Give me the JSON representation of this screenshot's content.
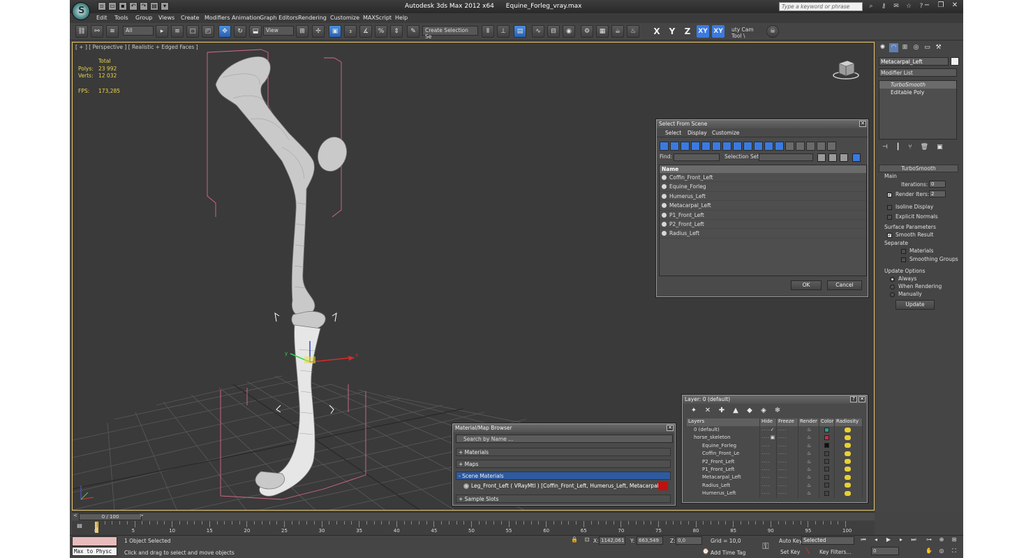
{
  "window": {
    "app_title": "Autodesk 3ds Max  2012 x64",
    "file_name": "Equine_Forleg_vray.max",
    "search_placeholder": "Type a keyword or phrase"
  },
  "menu": [
    "Edit",
    "Tools",
    "Group",
    "Views",
    "Create",
    "Modifiers",
    "Animation",
    "Graph Editors",
    "Rendering",
    "Customize",
    "MAXScript",
    "Help"
  ],
  "toolbar": {
    "selection_filter": "All",
    "reference_coord": "View",
    "named_selection_set": "Create Selection Se",
    "axes": [
      "X",
      "Y",
      "Z",
      "XY",
      "XY"
    ],
    "shortcut_tool": "uty Cam Tool \\"
  },
  "viewport": {
    "label": "[ + ] [ Perspective ] [ Realistic + Edged Faces ]",
    "stats_header": "Total",
    "polys_label": "Polys:",
    "polys_value": "23 992",
    "verts_label": "Verts:",
    "verts_value": "12 032",
    "fps_label": "FPS:",
    "fps_value": "173,285"
  },
  "select_from_scene": {
    "title": "Select From Scene",
    "menu": [
      "Select",
      "Display",
      "Customize"
    ],
    "find_label": "Find:",
    "selection_set_label": "Selection Set:",
    "column_name": "Name",
    "objects": [
      "Coffin_Front_Left",
      "Equine_Forleg",
      "Humerus_Left",
      "Metacarpal_Left",
      "P1_Front_Left",
      "P2_Front_Left",
      "Radius_Left"
    ],
    "ok_label": "OK",
    "cancel_label": "Cancel"
  },
  "layer_dialog": {
    "title": "Layer: 0 (default)",
    "help": "?",
    "columns": [
      "Layers",
      "Hide",
      "Freeze",
      "Render",
      "Color",
      "Radiosity"
    ],
    "rows": [
      {
        "name": "0 (default)",
        "indent": 1,
        "color": "#2a9a8a",
        "check": "✓"
      },
      {
        "name": "horse_skeleton",
        "indent": 1,
        "color": "#c0304a",
        "check": "▣"
      },
      {
        "name": "Equine_Forleg",
        "indent": 2,
        "color": "#111111",
        "check": ""
      },
      {
        "name": "Coffin_Front_Le",
        "indent": 2,
        "color": "#444444",
        "check": ""
      },
      {
        "name": "P2_Front_Left",
        "indent": 2,
        "color": "#444444",
        "check": ""
      },
      {
        "name": "P1_Front_Left",
        "indent": 2,
        "color": "#444444",
        "check": ""
      },
      {
        "name": "Metacarpal_Left",
        "indent": 2,
        "color": "#444444",
        "check": ""
      },
      {
        "name": "Radius_Left",
        "indent": 2,
        "color": "#444444",
        "check": ""
      },
      {
        "name": "Humerus_Left",
        "indent": 2,
        "color": "#444444",
        "check": ""
      }
    ]
  },
  "material_browser": {
    "title": "Material/Map Browser",
    "search_placeholder": "Search by Name ...",
    "sections": [
      "+ Materials",
      "+ Maps",
      "- Scene Materials",
      "+ Sample Slots"
    ],
    "scene_material": "Leg_Front_Left  ( VRayMtl ) [Coffin_Front_Left, Humerus_Left, Metacarpal_Left, ..."
  },
  "command_panel": {
    "object_name": "Metacarpal_Left",
    "modifier_list": "Modifier List",
    "stack": [
      "TurboSmooth",
      "Editable Poly"
    ],
    "turbosmooth": {
      "header": "TurboSmooth",
      "main": "Main",
      "iterations_label": "Iterations:",
      "iterations_value": "0",
      "render_iters_label": "Render Iters:",
      "render_iters_value": "2",
      "isoline": "Isoline Display",
      "explicit": "Explicit Normals",
      "surface_params": "Surface Parameters",
      "smooth_result": "Smooth Result",
      "separate": "Separate",
      "materials": "Materials",
      "smoothing_groups": "Smoothing Groups",
      "update_options": "Update Options",
      "always": "Always",
      "when_rendering": "When Rendering",
      "manually": "Manually",
      "update_button": "Update"
    }
  },
  "timeline": {
    "frame_display": "0 / 100",
    "ticks": [
      "0",
      "5",
      "10",
      "15",
      "20",
      "25",
      "30",
      "35",
      "40",
      "45",
      "50",
      "55",
      "60",
      "65",
      "70",
      "75",
      "80",
      "85",
      "90",
      "95",
      "100"
    ]
  },
  "status": {
    "maxscript_listener": "Max to Physc",
    "selection_info": "1 Object Selected",
    "prompt": "Click and drag to select and move objects",
    "x_label": "X:",
    "x_value": "1142,061",
    "y_label": "Y:",
    "y_value": "663,549",
    "z_label": "Z:",
    "z_value": "0,0",
    "grid": "Grid = 10,0",
    "add_time_tag": "Add Time Tag",
    "auto_key": "Auto Key",
    "set_key": "Set Key",
    "key_mode": "Selected",
    "key_filters": "Key Filters...",
    "current_frame": "0"
  },
  "colors": {
    "accent_blue": "#3a7ae0",
    "viewport_border": "#e8c86a",
    "stats_yellow": "#e8d44a",
    "bbox_pink": "#d86a8a"
  }
}
